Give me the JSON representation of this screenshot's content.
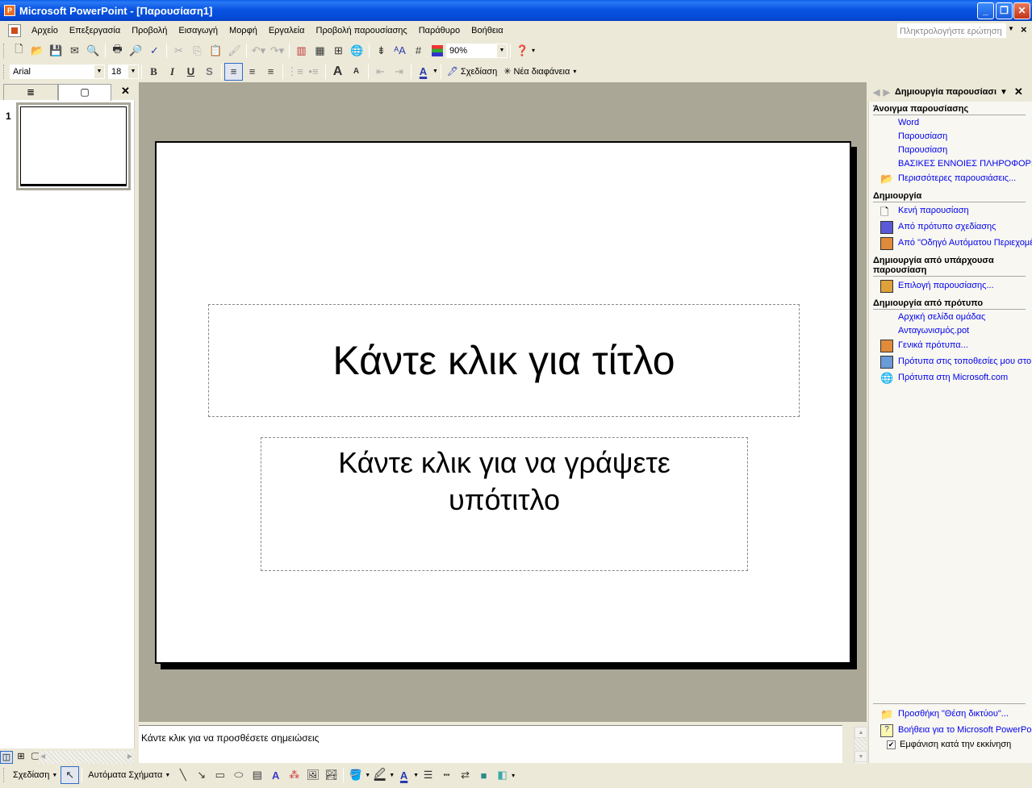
{
  "window": {
    "title": "Microsoft PowerPoint - [Παρουσίαση1]",
    "minimize": "_",
    "restore": "❐",
    "close": "✕"
  },
  "menubar": {
    "items": [
      "Αρχείο",
      "Επεξεργασία",
      "Προβολή",
      "Εισαγωγή",
      "Μορφή",
      "Εργαλεία",
      "Προβολή παρουσίασης",
      "Παράθυρο",
      "Βοήθεια"
    ],
    "ask_placeholder": "Πληκτρολογήστε ερώτηση"
  },
  "standard_toolbar": {
    "zoom": "90%",
    "icons": [
      "new-icon",
      "open-icon",
      "save-icon",
      "email-icon",
      "permission-icon",
      "print-icon",
      "print-preview-icon",
      "spelling-icon",
      "cut-icon",
      "copy-icon",
      "paste-icon",
      "format-painter-icon",
      "undo-icon",
      "redo-icon",
      "insert-chart-icon",
      "insert-table-icon",
      "tables-borders-icon",
      "hyperlink-icon",
      "expand-icon",
      "show-formatting-icon",
      "grid-icon",
      "color-grayscale-icon",
      "help-icon"
    ]
  },
  "formatting_toolbar": {
    "font": "Arial",
    "size": "18",
    "bold": "B",
    "italic": "I",
    "underline": "U",
    "shadow": "S",
    "design_label": "Σχεδίαση",
    "new_slide_label": "Νέα διαφάνεια"
  },
  "outline_pane": {
    "tab_outline": "≣",
    "tab_slides": "▢",
    "close": "✕",
    "slide_number": "1"
  },
  "slide": {
    "title_placeholder": "Κάντε κλικ για τίτλο",
    "subtitle_placeholder": "Κάντε κλικ για να γράψετε υπότιτλο"
  },
  "notes": {
    "placeholder": "Κάντε κλικ για να προσθέσετε σημειώσεις"
  },
  "task_pane": {
    "title": "Δημιουργία παρουσίασι",
    "sections": [
      {
        "heading": "Άνοιγμα παρουσίασης",
        "links": [
          "Word",
          "Παρουσίαση",
          "Παρουσίαση",
          "ΒΑΣΙΚΕΣ ΕΝΝΟΙΕΣ ΠΛΗΡΟΦΟΡΙΚΗ",
          "Περισσότερες παρουσιάσεις..."
        ]
      },
      {
        "heading": "Δημιουργία",
        "links": [
          "Κενή παρουσίαση",
          "Από πρότυπο σχεδίασης",
          "Από \"Οδηγό Αυτόματου Περιεχομέ"
        ]
      },
      {
        "heading": "Δημιουργία από υπάρχουσα παρουσίαση",
        "links": [
          "Επιλογή παρουσίασης..."
        ]
      },
      {
        "heading": "Δημιουργία από πρότυπο",
        "links": [
          "Αρχική σελίδα ομάδας",
          "Ανταγωνισμός.pot",
          "Γενικά πρότυπα...",
          "Πρότυπα στις τοποθεσίες μου στο \"",
          "Πρότυπα στη Microsoft.com"
        ]
      }
    ],
    "footer_links": [
      "Προσθήκη \"Θέση δικτύου\"...",
      "Βοήθεια για το Microsoft PowerPoint"
    ],
    "show_at_startup": "Εμφάνιση κατά την εκκίνηση",
    "show_at_startup_checked": true
  },
  "drawing_toolbar": {
    "draw_label": "Σχεδίαση",
    "autoshapes_label": "Αυτόματα Σχήματα"
  }
}
